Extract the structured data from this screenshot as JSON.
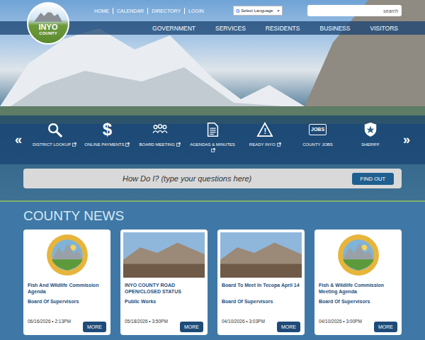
{
  "logo": {
    "line1": "INYO",
    "line2": "COUNTY"
  },
  "top_links": [
    "HOME",
    "CALENDAR",
    "DIRECTORY",
    "LOGIN"
  ],
  "language": {
    "icon": "G",
    "label": "Select Language",
    "arrow": "▼"
  },
  "search": {
    "placeholder": "search"
  },
  "nav": [
    "GOVERNMENT",
    "SERVICES",
    "RESIDENTS",
    "BUSINESS",
    "VISITORS"
  ],
  "quick_links": {
    "prev": "«",
    "next": "»",
    "items": [
      {
        "label": "DISTRICT LOOKUP",
        "kind": "magnifier",
        "glyph": "",
        "external": true
      },
      {
        "label": "ONLINE PAYMENTS",
        "kind": "glyph",
        "glyph": "$",
        "external": true
      },
      {
        "label": "BOARD MEETING",
        "kind": "people",
        "glyph": "",
        "external": true
      },
      {
        "label": "AGENDAS & MINUTES",
        "kind": "document",
        "glyph": "",
        "external": true
      },
      {
        "label": "READY INYO",
        "kind": "warning",
        "glyph": "!",
        "external": true
      },
      {
        "label": "COUNTY JOBS",
        "kind": "jobs",
        "glyph": "JOBS",
        "external": false
      },
      {
        "label": "SHERIFF",
        "kind": "badge",
        "glyph": "",
        "external": false
      }
    ]
  },
  "how_do_i": {
    "placeholder": "How Do I? (type your questions here)",
    "button": "FIND OUT"
  },
  "news": {
    "heading": "COUNTY NEWS",
    "cards": [
      {
        "image": "seal",
        "title": "Fish And Wildlife Commission Agenda",
        "category": "Board Of Supervisors",
        "date": "06/16/2026 • 2:13PM",
        "more": "MORE"
      },
      {
        "image": "photo",
        "title": "INYO COUNTY ROAD OPEN/CLOSED STATUS",
        "category": "Public Works",
        "date": "05/18/2026 • 3:50PM",
        "more": "MORE"
      },
      {
        "image": "photo",
        "title": "Board To Meet In Tecopa April 14",
        "category": "Board Of Supervisors",
        "date": "04/10/2026 • 3:03PM",
        "more": "MORE"
      },
      {
        "image": "seal",
        "title": "Fish & Wildlife Commission Meeting Agenda",
        "category": "Board Of Supervisors",
        "date": "04/10/2026 • 3:00PM",
        "more": "MORE"
      }
    ]
  }
}
